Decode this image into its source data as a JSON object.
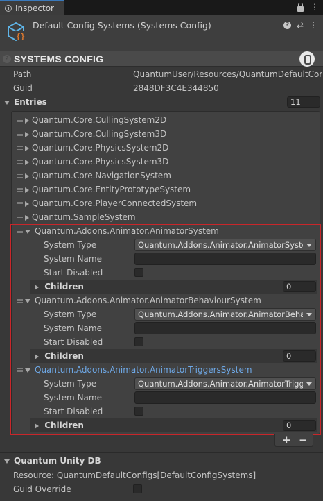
{
  "window": {
    "tab_label": "Inspector",
    "tab_menu_icon": "kebab-menu-icon",
    "lock_icon": "lock-icon"
  },
  "object": {
    "title": "Default Config Systems (Systems Config)",
    "icon": "config-asset-icon",
    "accent_color": "#e07a2f",
    "cube_color": "#5fb5e8"
  },
  "section": {
    "title": "SYSTEMS CONFIG",
    "help": "?"
  },
  "fields": {
    "path_label": "Path",
    "path_value": "QuantumUser/Resources/QuantumDefaultConfigs",
    "guid_label": "Guid",
    "guid_value": "2848DF3C4E344850",
    "entries_label": "Entries",
    "entries_count": "11"
  },
  "entries": [
    {
      "label": "Quantum.Core.CullingSystem2D"
    },
    {
      "label": "Quantum.Core.CullingSystem3D"
    },
    {
      "label": "Quantum.Core.PhysicsSystem2D"
    },
    {
      "label": "Quantum.Core.PhysicsSystem3D"
    },
    {
      "label": "Quantum.Core.NavigationSystem"
    },
    {
      "label": "Quantum.Core.EntityPrototypeSystem"
    },
    {
      "label": "Quantum.Core.PlayerConnectedSystem"
    },
    {
      "label": "Quantum.SampleSystem"
    }
  ],
  "expanded": [
    {
      "label": "Quantum.Addons.Animator.AnimatorSystem",
      "system_type_label": "System Type",
      "system_type_value": "Quantum.Addons.Animator.AnimatorSystem",
      "system_name_label": "System Name",
      "start_disabled_label": "Start Disabled",
      "children_label": "Children",
      "children_count": "0"
    },
    {
      "label": "Quantum.Addons.Animator.AnimatorBehaviourSystem",
      "system_type_label": "System Type",
      "system_type_value": "Quantum.Addons.Animator.AnimatorBehaviourSystem",
      "system_name_label": "System Name",
      "start_disabled_label": "Start Disabled",
      "children_label": "Children",
      "children_count": "0"
    },
    {
      "label": "Quantum.Addons.Animator.AnimatorTriggersSystem",
      "system_type_label": "System Type",
      "system_type_value": "Quantum.Addons.Animator.AnimatorTriggersSystem",
      "system_name_label": "System Name",
      "start_disabled_label": "Start Disabled",
      "children_label": "Children",
      "children_count": "0"
    }
  ],
  "list_buttons": {
    "add": "+",
    "remove": "−"
  },
  "db": {
    "title": "Quantum Unity DB",
    "resource": "Resource: QuantumDefaultConfigs[DefaultConfigSystems]",
    "guid_override_label": "Guid Override"
  },
  "colors": {
    "selection": "#6ea8e6",
    "highlight": "#c9262a",
    "tab_accent": "#3a79bb"
  }
}
